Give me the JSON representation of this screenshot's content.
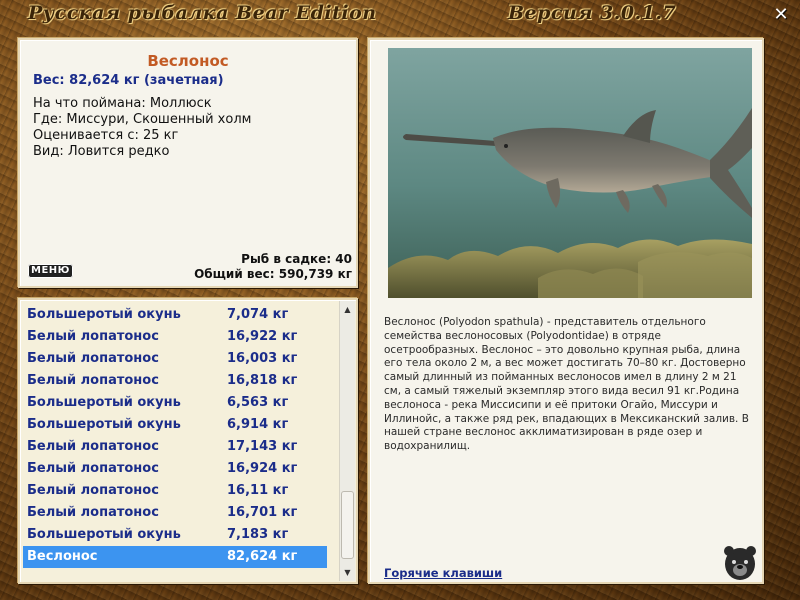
{
  "app": {
    "title_left": "Русская рыбалка Bear Edition",
    "title_right": "Версия 3.0.1.7",
    "close_symbol": "✕"
  },
  "catch_info": {
    "name": "Веслонос",
    "weight": "Вес: 82,624 кг (зачетная)",
    "bait": "На что поймана: Моллюск",
    "location": "Где: Миссури, Скошенный холм",
    "valued_from": "Оценивается с: 25 кг",
    "species_note": "Вид: Ловится редко",
    "menu_button": "МЕНЮ",
    "fish_in_net": "Рыб в садке: 40",
    "total_weight": "Общий вес: 590,739 кг"
  },
  "catch_list": {
    "rows": [
      {
        "name": "Большеротый окунь",
        "weight": "7,074 кг"
      },
      {
        "name": "Белый лопатонос",
        "weight": "16,922 кг"
      },
      {
        "name": "Белый лопатонос",
        "weight": "16,003 кг"
      },
      {
        "name": "Белый лопатонос",
        "weight": "16,818 кг"
      },
      {
        "name": "Большеротый окунь",
        "weight": "6,563 кг"
      },
      {
        "name": "Большеротый окунь",
        "weight": "6,914 кг"
      },
      {
        "name": "Белый лопатонос",
        "weight": "17,143 кг"
      },
      {
        "name": "Белый лопатонос",
        "weight": "16,924 кг"
      },
      {
        "name": "Белый лопатонос",
        "weight": "16,11 кг"
      },
      {
        "name": "Белый лопатонос",
        "weight": "16,701 кг"
      },
      {
        "name": "Большеротый окунь",
        "weight": "7,183 кг"
      },
      {
        "name": "Веслонос",
        "weight": "82,624 кг",
        "selected": true
      }
    ]
  },
  "description": {
    "text": "Веслонос (Polyodon spathula) - представитель отдельного семейства веслоносовых (Polyodontidae) в отряде осетрообразных.  Веслонос – это довольно крупная рыба, длина его тела около 2 м, а вес может достигать 70–80 кг. Достоверно самый длинный из пойманных веслоносов имел в длину 2 м 21 см, а самый тяжелый экземпляр этого вида весил 91 кг.Родина веслоноса - река Миссисипи и её притоки Огайо, Миссури и Иллинойс, а также ряд рек, впадающих в Мексиканский залив. В нашей стране веслонос акклиматизирован в ряде озер и водохранилищ.",
    "hotkeys_link": "Горячие клавиши"
  },
  "colors": {
    "fish_name": "#c25a24",
    "accent_blue": "#1b2d8a",
    "selection": "#3c94f0"
  }
}
